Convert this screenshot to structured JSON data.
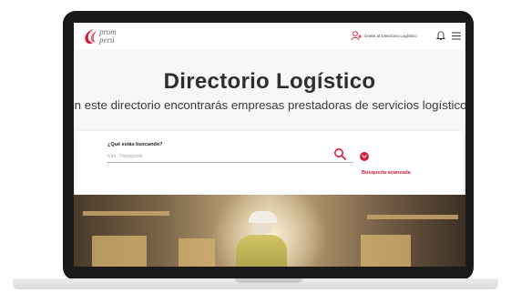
{
  "header": {
    "logo_line1": "prom",
    "logo_line2": "perú",
    "join_label": "Únete al Directorio Logístico",
    "icons": [
      "add-user-icon",
      "bell-icon",
      "menu-icon"
    ]
  },
  "hero": {
    "title": "Directorio Logístico",
    "subtitle": "En este directorio encontrarás empresas prestadoras de servicios logísticos"
  },
  "search": {
    "label": "¿Qué estás buscando?",
    "placeholder": "Ejm: Transporte",
    "value": "",
    "advanced_label": "Búsqueda avanzada"
  },
  "colors": {
    "accent": "#d71f3f",
    "text_dark": "#2e2e2e",
    "background": "#f7f7f7"
  }
}
